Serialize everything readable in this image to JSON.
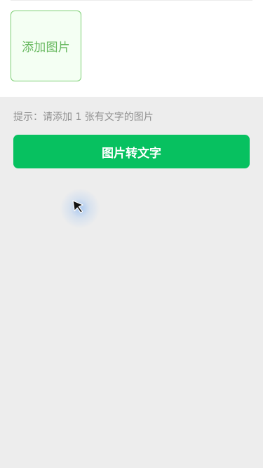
{
  "upload": {
    "add_image_label": "添加图片"
  },
  "hint": {
    "text": "提示：请添加 1 张有文字的图片"
  },
  "actions": {
    "convert_label": "图片转文字"
  },
  "colors": {
    "primary": "#07c160",
    "tile_border": "#7ccf73",
    "tile_text": "#67b85f",
    "background": "#ededed",
    "panel": "#ffffff"
  },
  "icons": {
    "cursor": "cursor-icon"
  }
}
